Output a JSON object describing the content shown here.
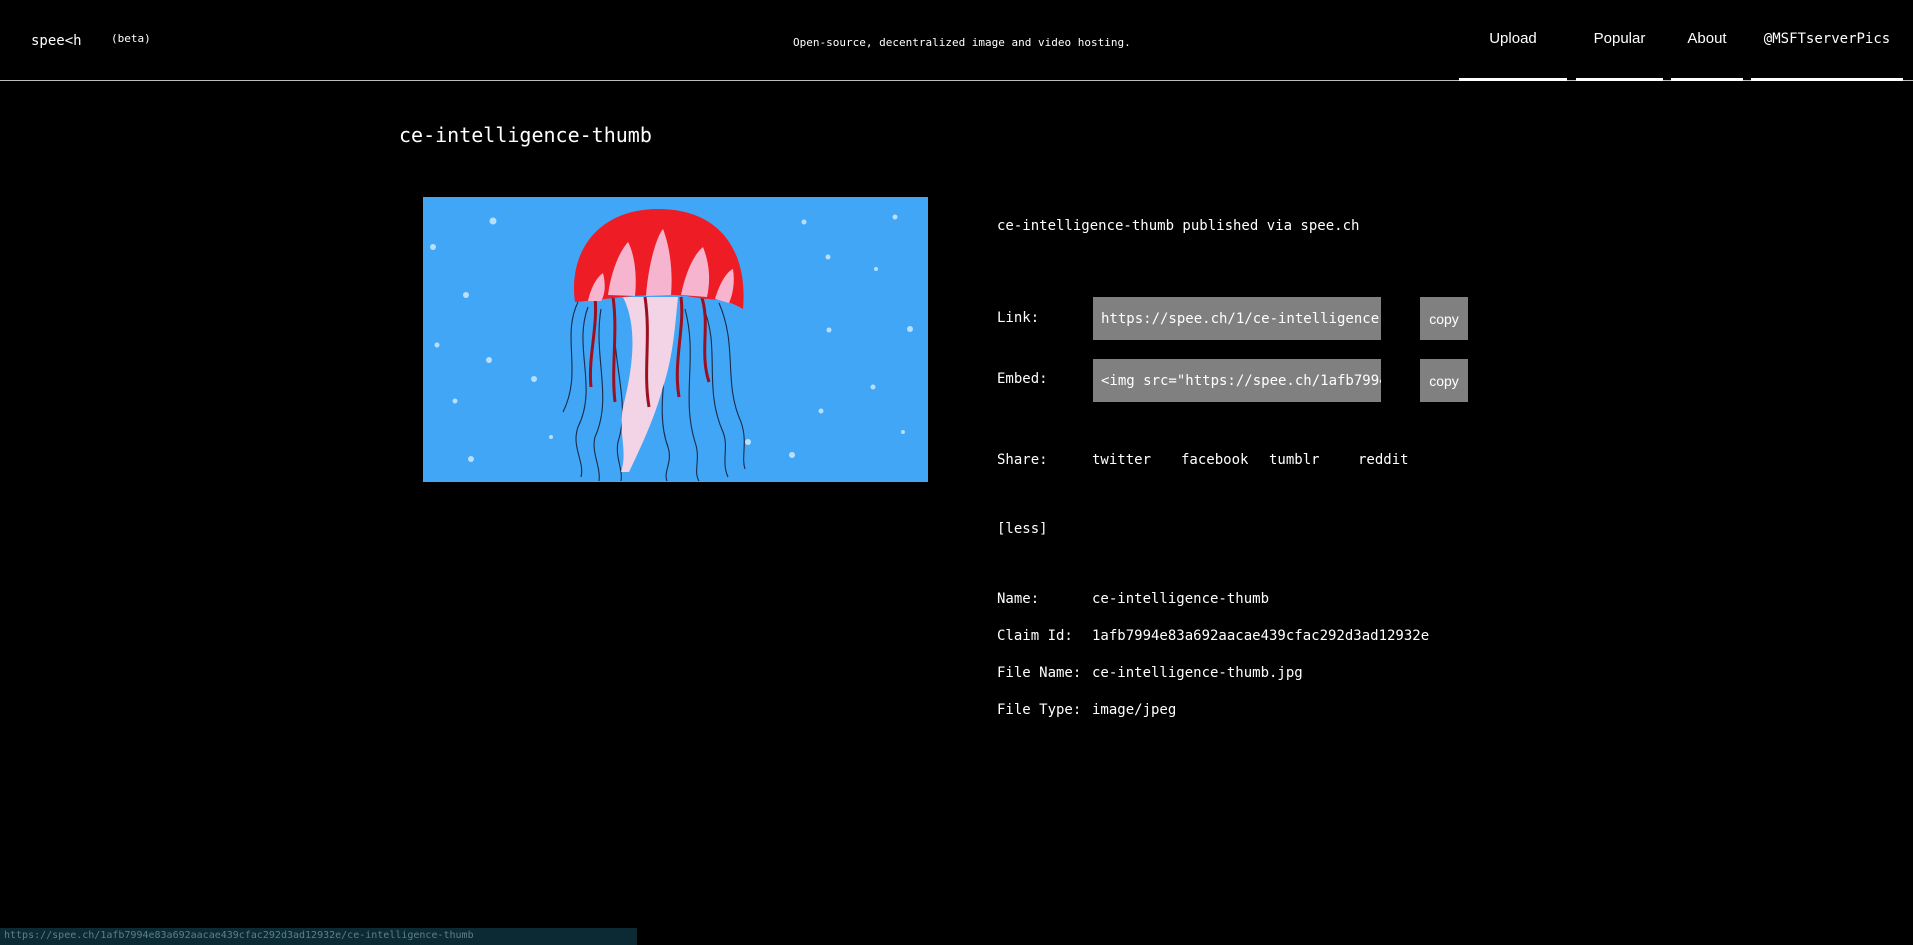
{
  "header": {
    "brand": "spee<h",
    "beta": "(beta)",
    "tagline": "Open-source, decentralized image and video hosting.",
    "nav": [
      {
        "label": "Upload"
      },
      {
        "label": "Popular"
      },
      {
        "label": "About"
      },
      {
        "label": "@MSFTserverPics"
      }
    ]
  },
  "asset": {
    "title": "ce-intelligence-thumb",
    "published": "ce-intelligence-thumb published via spee.ch",
    "link_label": "Link:",
    "link_value": "https://spee.ch/1/ce-intelligence-",
    "embed_label": "Embed:",
    "embed_value": "<img src=\"https://spee.ch/1afb7994",
    "copy_label": "copy",
    "share_label": "Share:",
    "share": [
      "twitter",
      "facebook",
      "tumblr",
      "reddit"
    ],
    "toggle": "[less]",
    "details": [
      {
        "label": "Name:",
        "value": "ce-intelligence-thumb"
      },
      {
        "label": "Claim Id:",
        "value": "1afb7994e83a692aacae439cfac292d3ad12932e"
      },
      {
        "label": "File Name:",
        "value": "ce-intelligence-thumb.jpg"
      },
      {
        "label": "File Type:",
        "value": "image/jpeg"
      }
    ]
  },
  "status": {
    "url": "https://spee.ch/1afb7994e83a692aacae439cfac292d3ad12932e/ce-intelligence-thumb"
  },
  "colors": {
    "background": "#000000",
    "field": "#808080",
    "preview_bg": "#41a6f5",
    "jelly_red": "#ee1c25"
  },
  "icons": {
    "preview": "jellyfish-image"
  }
}
